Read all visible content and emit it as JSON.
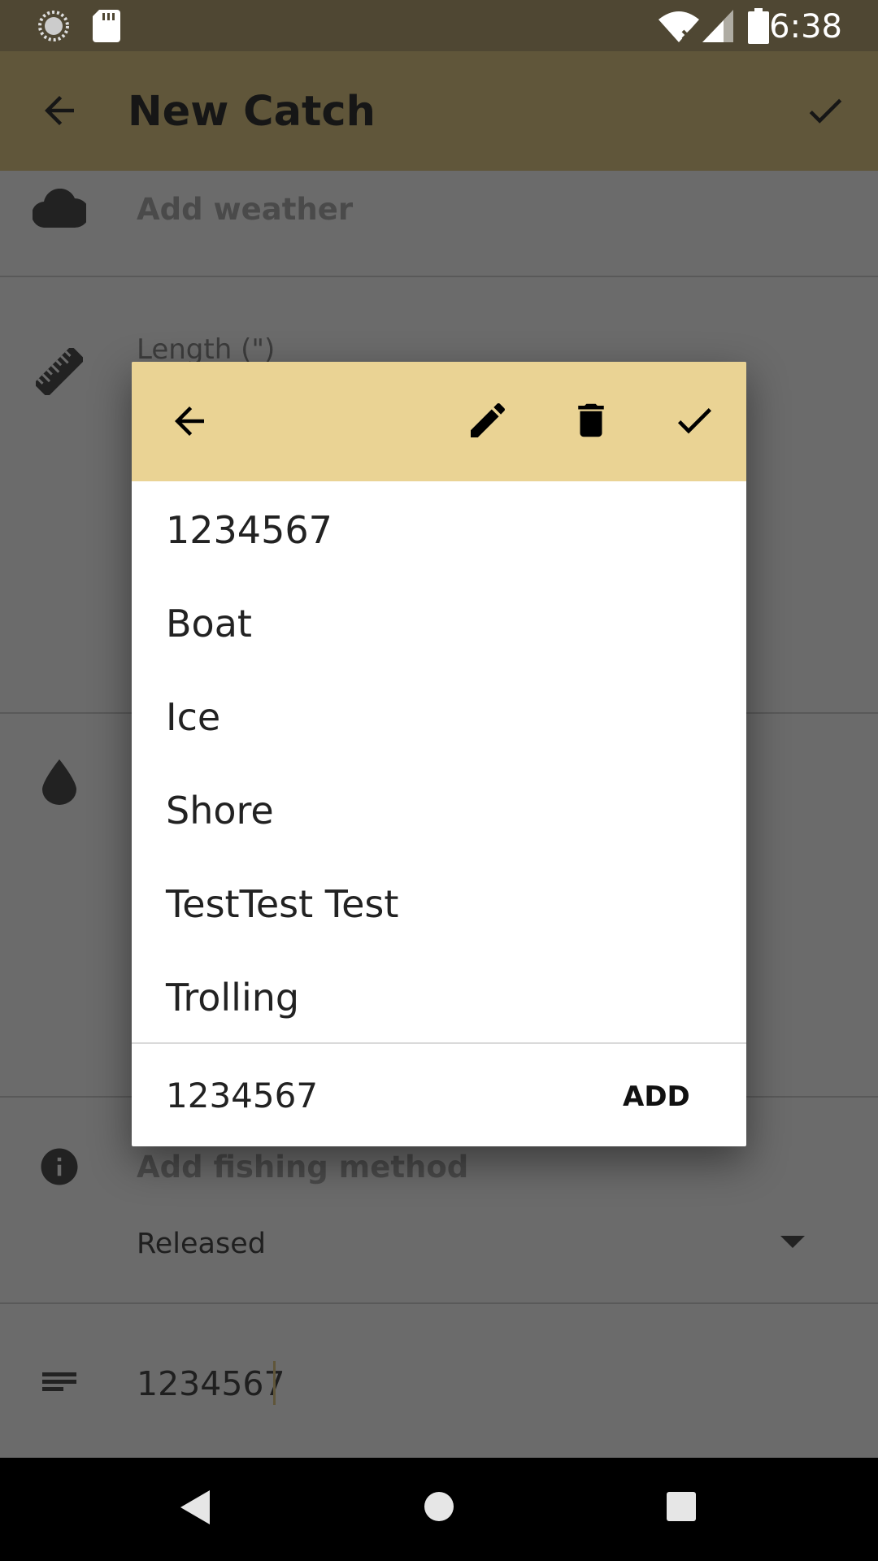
{
  "status_bar": {
    "time": "6:38"
  },
  "app_bar": {
    "title": "New Catch"
  },
  "form": {
    "weather_placeholder": "Add weather",
    "length_label": "Length (\")",
    "fishing_method_placeholder": "Add fishing method",
    "released_value": "Released",
    "notes_value": "1234567"
  },
  "dialog": {
    "items": [
      "1234567",
      "Boat",
      "Ice",
      "Shore",
      "TestTest Test",
      "Trolling"
    ],
    "input_value": "1234567",
    "add_label": "ADD"
  },
  "colors": {
    "status_bar": "#4f4733",
    "app_bar": "#60563a",
    "dialog_header": "#ead394",
    "scrim_background": "#6b6b6b"
  }
}
